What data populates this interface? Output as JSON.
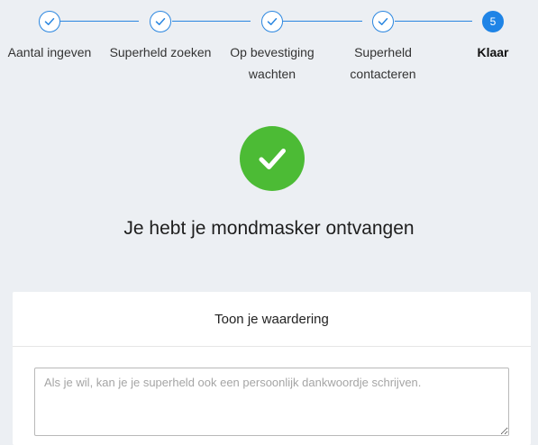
{
  "stepper": {
    "steps": [
      {
        "label": "Aantal ingeven",
        "state": "done"
      },
      {
        "label": "Superheld zoeken",
        "state": "done"
      },
      {
        "label": "Op bevestiging wachten",
        "state": "done"
      },
      {
        "label": "Superheld contacteren",
        "state": "done"
      },
      {
        "label": "Klaar",
        "state": "active",
        "number": "5"
      }
    ],
    "accent_color": "#1f84e6",
    "check_icon": "check-icon"
  },
  "success": {
    "icon": "check-circle-icon",
    "color": "#4cbb35",
    "headline": "Je hebt je mondmasker ontvangen"
  },
  "appreciation": {
    "title": "Toon je waardering",
    "placeholder": "Als je wil, kan je je superheld ook een persoonlijk dankwoordje schrijven."
  }
}
